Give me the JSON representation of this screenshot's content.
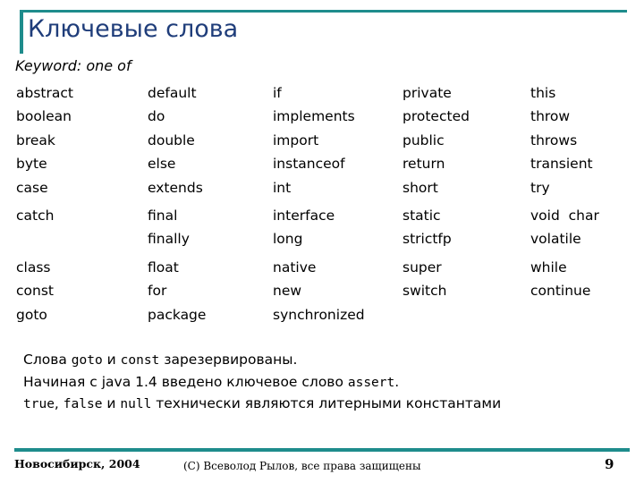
{
  "theme": {
    "accent_color": "#1E8C8C",
    "title_color": "#1F3D7A",
    "text_color": "#000000",
    "background_color": "#FFFFFF"
  },
  "slide": {
    "title": "Ключевые слова",
    "subtitle": "Keyword: one of"
  },
  "keywords": {
    "columns": 5,
    "rows": [
      [
        "abstract",
        "default",
        "if",
        "private",
        "this"
      ],
      [
        "boolean",
        "do",
        "implements",
        "protected",
        "throw"
      ],
      [
        "break",
        "double",
        "import",
        "public",
        "throws"
      ],
      [
        "byte",
        "else",
        "instanceof",
        "return",
        "transient"
      ],
      [
        "case",
        "extends",
        "int",
        "short",
        "try"
      ],
      [
        "catch",
        "final",
        "interface",
        "static",
        "void  char"
      ],
      [
        "",
        "finally",
        "long",
        "strictfp",
        "volatile"
      ],
      [
        "class",
        "float",
        "native",
        "super",
        "while"
      ],
      [
        "const",
        "for",
        "new",
        "switch",
        "continue"
      ],
      [
        "goto",
        "package",
        "synchronized",
        "",
        ""
      ]
    ]
  },
  "notes": [
    {
      "parts": [
        {
          "text": "Слова ",
          "code": false
        },
        {
          "text": "goto",
          "code": true
        },
        {
          "text": " и ",
          "code": false
        },
        {
          "text": "const",
          "code": true
        },
        {
          "text": " зарезервированы.",
          "code": false
        }
      ]
    },
    {
      "parts": [
        {
          "text": "Начиная с java 1.4 введено ключевое слово ",
          "code": false
        },
        {
          "text": "assert",
          "code": true
        },
        {
          "text": ".",
          "code": false
        }
      ]
    },
    {
      "parts": [
        {
          "text": "true",
          "code": true
        },
        {
          "text": ", ",
          "code": false
        },
        {
          "text": "false",
          "code": true
        },
        {
          "text": " и ",
          "code": false
        },
        {
          "text": "null",
          "code": true
        },
        {
          "text": " технически являются литерными константами",
          "code": false
        }
      ]
    }
  ],
  "footer": {
    "left": "Новосибирск, 2004",
    "center": "(C) Всеволод Рылов, все права защищены",
    "page_number": "9"
  }
}
